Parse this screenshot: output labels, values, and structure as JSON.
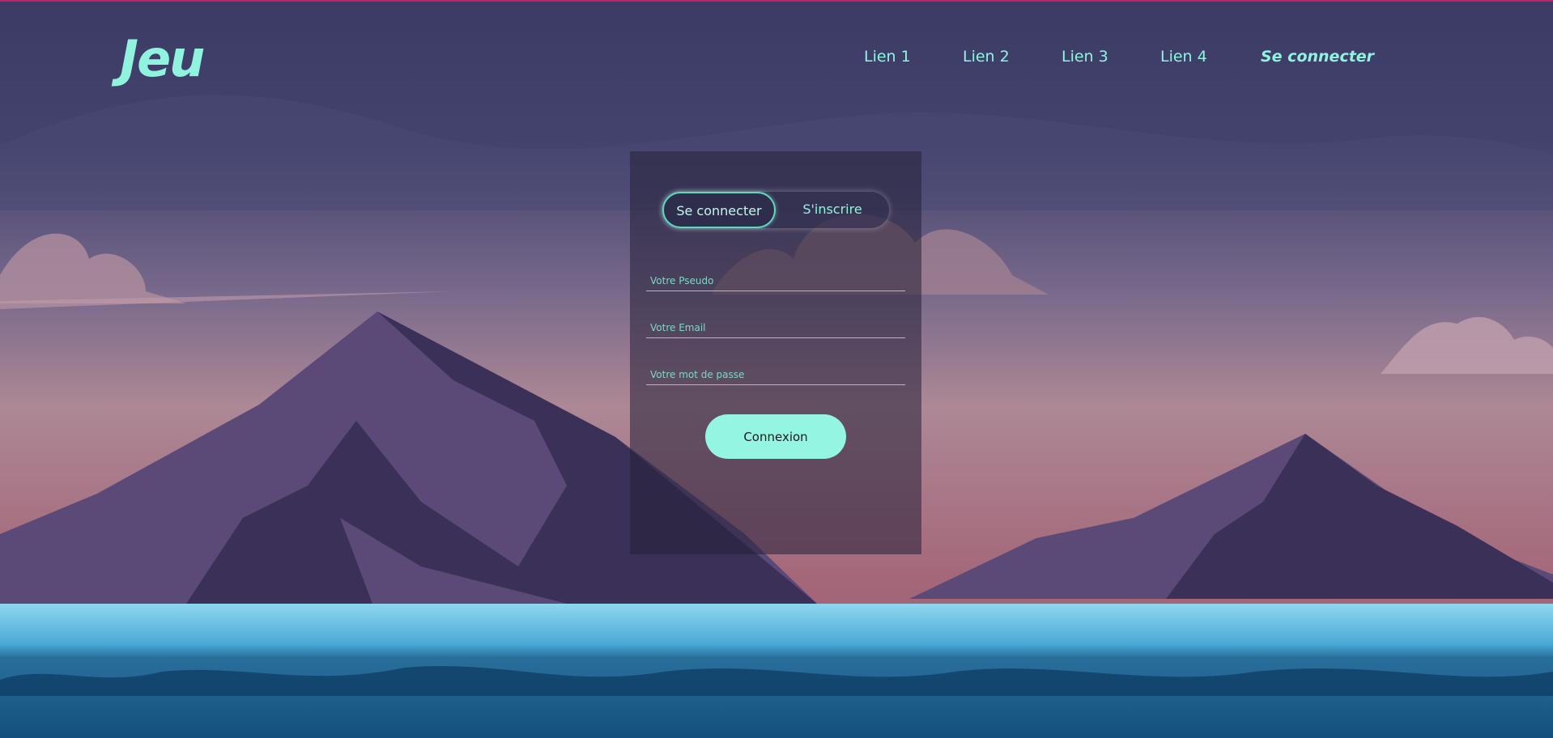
{
  "header": {
    "logo": "Jeu",
    "nav": [
      "Lien 1",
      "Lien 2",
      "Lien 3",
      "Lien 4"
    ],
    "login_link": "Se connecter"
  },
  "form": {
    "tabs": {
      "login": "Se connecter",
      "signup": "S'inscrire"
    },
    "fields": {
      "pseudo_placeholder": "Votre Pseudo",
      "email_placeholder": "Votre Email",
      "password_placeholder": "Votre mot de passe"
    },
    "submit": "Connexion"
  },
  "colors": {
    "accent": "#94f5e3",
    "top_bar": "#c2246a"
  }
}
